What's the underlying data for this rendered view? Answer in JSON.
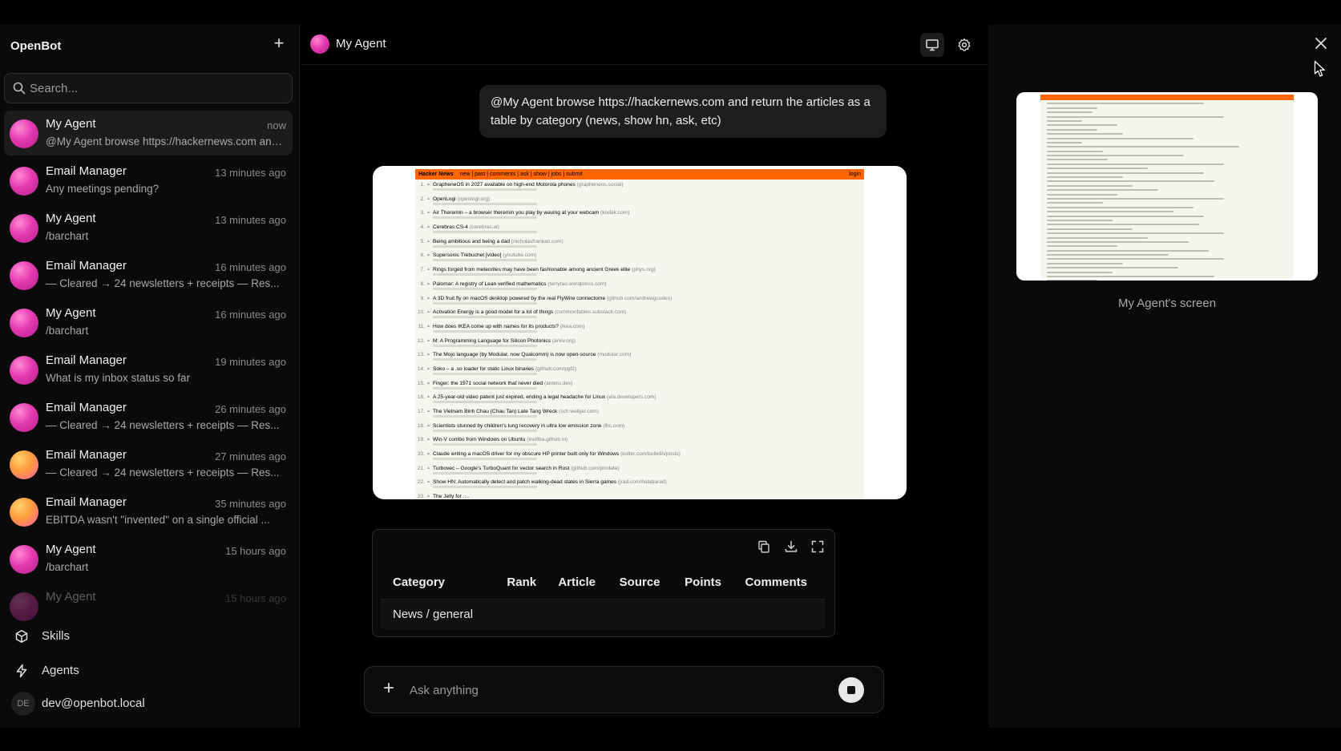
{
  "app": {
    "name": "OpenBot",
    "new_label": "+"
  },
  "search": {
    "placeholder": "Search..."
  },
  "conversations": [
    {
      "title": "My Agent",
      "time": "now",
      "preview": "@My Agent browse https://hackernews.com and return the articles as a table by category (news, show hn, ask, etc)",
      "avatar": "pink"
    },
    {
      "title": "Email Manager",
      "time": "13 minutes ago",
      "preview": "Any meetings pending?",
      "avatar": "pink"
    },
    {
      "title": "My Agent",
      "time": "13 minutes ago",
      "preview": "/barchart",
      "avatar": "pink"
    },
    {
      "title": "Email Manager",
      "time": "16 minutes ago",
      "preview": "— Cleared → 24 newsletters + receipts — Res...",
      "avatar": "pink"
    },
    {
      "title": "My Agent",
      "time": "16 minutes ago",
      "preview": "/barchart",
      "avatar": "pink"
    },
    {
      "title": "Email Manager",
      "time": "19 minutes ago",
      "preview": "What is my inbox status so far",
      "avatar": "pink"
    },
    {
      "title": "Email Manager",
      "time": "26 minutes ago",
      "preview": "— Cleared → 24 newsletters + receipts — Res...",
      "avatar": "pink"
    },
    {
      "title": "Email Manager",
      "time": "27 minutes ago",
      "preview": "— Cleared → 24 newsletters + receipts — Res...",
      "avatar": "orange"
    },
    {
      "title": "Email Manager",
      "time": "35 minutes ago",
      "preview": "EBITDA wasn't \"invented\" on a single official ...",
      "avatar": "orange"
    },
    {
      "title": "My Agent",
      "time": "15 hours ago",
      "preview": "/barchart",
      "avatar": "pink"
    },
    {
      "title": "My Agent",
      "time": "15 hours ago",
      "preview": "",
      "avatar": "pink"
    }
  ],
  "nav": {
    "skills": "Skills",
    "agents": "Agents"
  },
  "user": {
    "initials": "DE",
    "email": "dev@openbot.local"
  },
  "chat": {
    "agent_name": "My Agent",
    "user_message": "@My Agent browse https://hackernews.com and return the articles as a table by category (news, show hn, ask, etc)",
    "composer_placeholder": "Ask anything"
  },
  "hn_screenshot": {
    "brand": "Hacker News",
    "menu": "new | past | comments | ask | show | jobs | submit",
    "login": "login",
    "items": [
      {
        "rank": "1.",
        "title": "GrapheneOS in 2027 available on high-end Motorola phones",
        "domain": "(grapheneos.social)"
      },
      {
        "rank": "2.",
        "title": "OpenLogi",
        "domain": "(openlogi.org)"
      },
      {
        "rank": "3.",
        "title": "Air Theremin – a browser theremin you play by waving at your webcam",
        "domain": "(kodak.com)"
      },
      {
        "rank": "4.",
        "title": "Cerebras CS-4",
        "domain": "(cerebras.ai)"
      },
      {
        "rank": "5.",
        "title": "Being ambitious and being a dad",
        "domain": "(nicholasfrankan.com)"
      },
      {
        "rank": "6.",
        "title": "Supersonic Trebuchet [video]",
        "domain": "(youtube.com)"
      },
      {
        "rank": "7.",
        "title": "Rings forged from meteorites may have been fashionable among ancient Greek elite",
        "domain": "(phys.org)"
      },
      {
        "rank": "8.",
        "title": "Palomar: A registry of Lean verified mathematics",
        "domain": "(terrytao.wordpress.com)"
      },
      {
        "rank": "9.",
        "title": "A 3D fruit fly on macOS desktop powered by the real FlyWire connectome",
        "domain": "(github.com/andrewgcodes)"
      },
      {
        "rank": "10.",
        "title": "Activation Energy is a good model for a lot of things",
        "domain": "(commonfables.substack.com)"
      },
      {
        "rank": "11.",
        "title": "How does IKEA come up with names for its products?",
        "domain": "(ikea.com)"
      },
      {
        "rank": "12.",
        "title": "M: A Programming Language for Silicon Photonics",
        "domain": "(arxiv.org)"
      },
      {
        "rank": "13.",
        "title": "The Mojo language (by Modular, now Qualcomm) is now open-source",
        "domain": "(modular.com)"
      },
      {
        "rank": "14.",
        "title": "Soko – a .so loader for static Linux binaries",
        "domain": "(github.com/pgf2)"
      },
      {
        "rank": "15.",
        "title": "Finger: the 1971 social network that never died",
        "domain": "(anteru.dev)"
      },
      {
        "rank": "16.",
        "title": "A 25-year-old video patent just expired, ending a legal headache for Linux",
        "domain": "(ela.developers.com)"
      },
      {
        "rank": "17.",
        "title": "The Vietnam Binh Chau (Chau Tan) Late Tang Wreck",
        "domain": "(sch.webjar.com)"
      },
      {
        "rank": "18.",
        "title": "Scientists stunned by children's lung recovery in ultra low emission zone",
        "domain": "(lbc.com)"
      },
      {
        "rank": "19.",
        "title": "Win-V combo from Windows on Ubuntu",
        "domain": "(inu9ba.github.io)"
      },
      {
        "rank": "20.",
        "title": "Claude writing a macOS driver for my obscure HP printer built only for Windows",
        "domain": "(kolter.com/bulletin/posts)"
      },
      {
        "rank": "21.",
        "title": "Turbovec – Google's TurboQuant for vector search in Rust",
        "domain": "(github.com/pmdata)"
      },
      {
        "rank": "22.",
        "title": "Show HN: Automatically detect and patch walking-dead states in Sierra games",
        "domain": "(jrad.com/halabarad)"
      },
      {
        "rank": "23.",
        "title": "The Jelly for ....",
        "domain": ""
      }
    ]
  },
  "result_table": {
    "columns": [
      "Category",
      "Rank",
      "Article",
      "Source",
      "Points",
      "Comments"
    ],
    "rows": [
      [
        "News / general",
        "",
        "",
        "",
        "",
        ""
      ]
    ]
  },
  "right_panel": {
    "screen_label": "My Agent's screen"
  },
  "colors": {
    "accent_pink": "#e43ab0",
    "accent_orange": "#ff9a3d",
    "hn_orange": "#ff6600"
  }
}
